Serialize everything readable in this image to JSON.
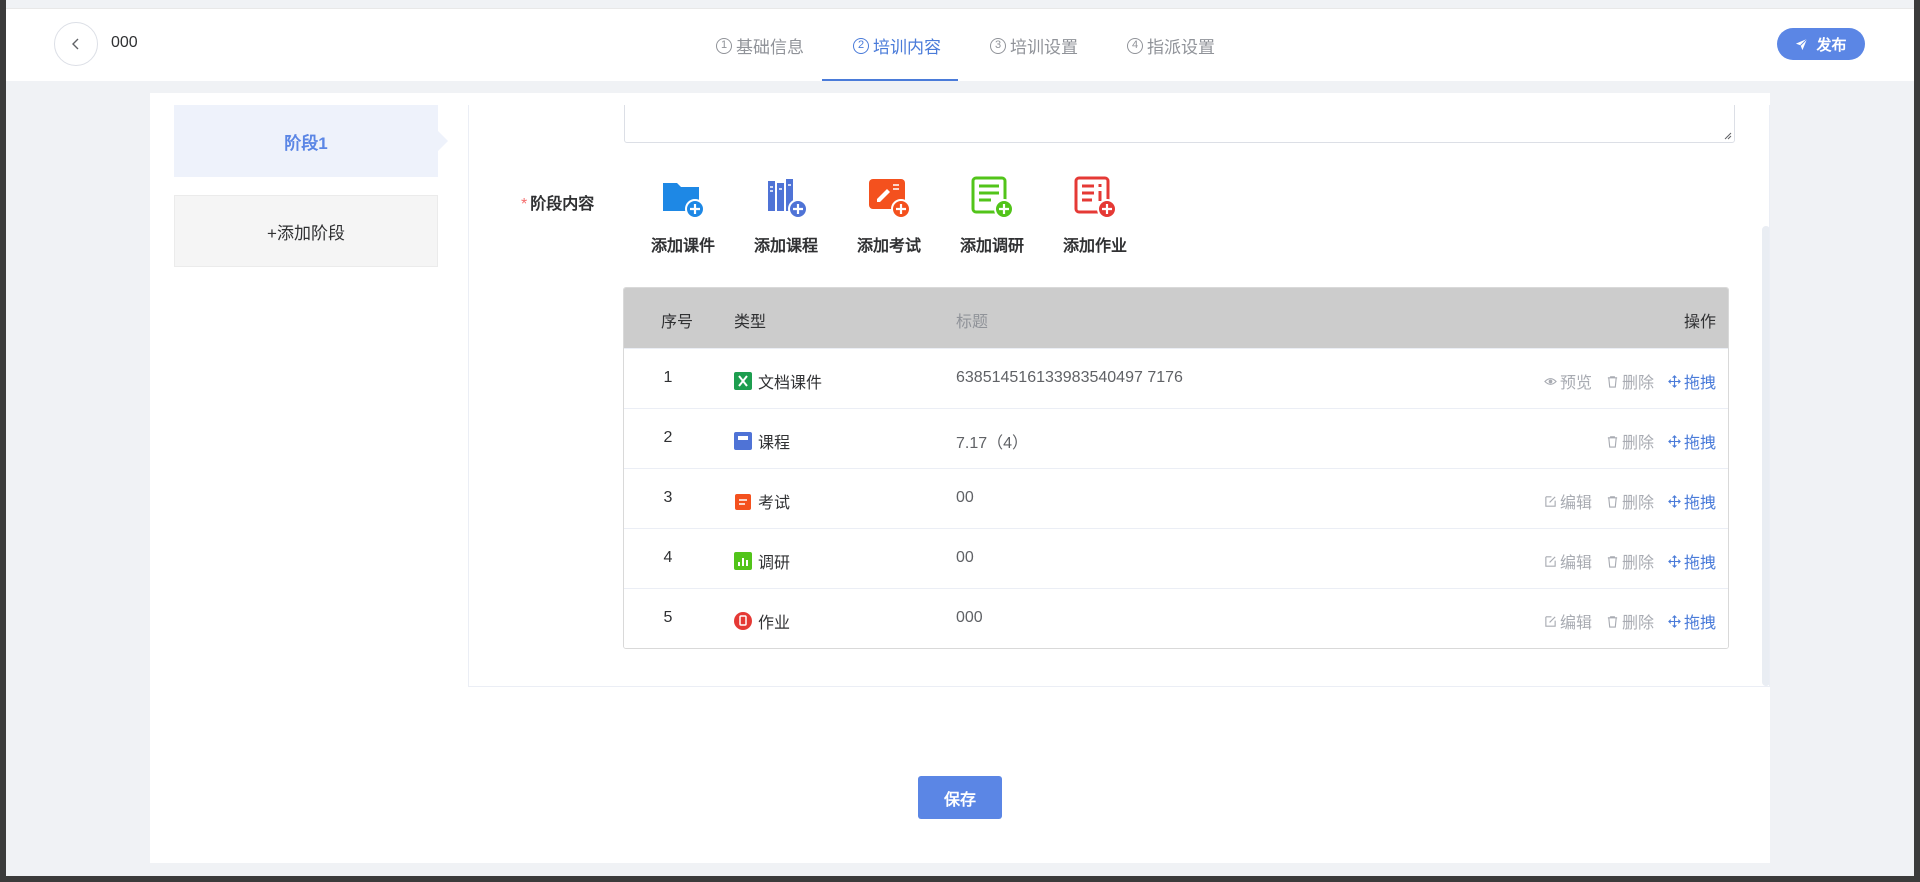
{
  "header": {
    "title": "000",
    "steps": [
      {
        "num": "1",
        "label": "基础信息"
      },
      {
        "num": "2",
        "label": "培训内容"
      },
      {
        "num": "3",
        "label": "培训设置"
      },
      {
        "num": "4",
        "label": "指派设置"
      }
    ],
    "active_step": 1,
    "publish_label": "发布"
  },
  "stages": {
    "items": [
      {
        "label": "阶段1"
      }
    ],
    "add_label": "+添加阶段"
  },
  "form": {
    "required_mark": "*",
    "content_label": "阶段内容",
    "add_buttons": [
      {
        "label": "添加课件",
        "icon": "folder-add-icon",
        "color": "#1e88e5"
      },
      {
        "label": "添加课程",
        "icon": "books-add-icon",
        "color": "#4f73d6"
      },
      {
        "label": "添加考试",
        "icon": "exam-add-icon",
        "color": "#f4511e"
      },
      {
        "label": "添加调研",
        "icon": "survey-add-icon",
        "color": "#52c41a"
      },
      {
        "label": "添加作业",
        "icon": "homework-add-icon",
        "color": "#e53935"
      }
    ]
  },
  "table": {
    "headers": {
      "seq": "序号",
      "type": "类型",
      "title": "标题",
      "ops": "操作"
    },
    "rows": [
      {
        "seq": "1",
        "type": "文档课件",
        "type_icon": "excel-icon",
        "title": "638514516133983540497 7176",
        "ops": [
          "预览",
          "删除",
          "拖拽"
        ]
      },
      {
        "seq": "2",
        "type": "课程",
        "type_icon": "course-icon",
        "title": "7.17（4）",
        "ops": [
          "删除",
          "拖拽"
        ]
      },
      {
        "seq": "3",
        "type": "考试",
        "type_icon": "exam-icon",
        "title": "00",
        "ops": [
          "编辑",
          "删除",
          "拖拽"
        ]
      },
      {
        "seq": "4",
        "type": "调研",
        "type_icon": "survey-icon",
        "title": "00",
        "ops": [
          "编辑",
          "删除",
          "拖拽"
        ]
      },
      {
        "seq": "5",
        "type": "作业",
        "type_icon": "homework-icon",
        "title": "000",
        "ops": [
          "编辑",
          "删除",
          "拖拽"
        ]
      }
    ]
  },
  "save_label": "保存",
  "colors": {
    "accent": "#5b86e5",
    "required": "#f56c6c",
    "table_header": "#cccccc"
  }
}
